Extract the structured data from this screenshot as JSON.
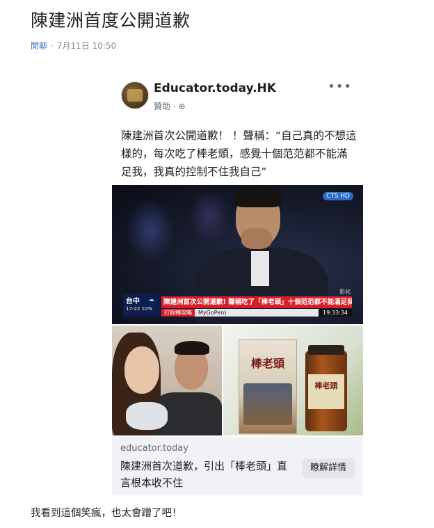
{
  "article": {
    "title": "陳建洲首度公開道歉",
    "category": "閒聊",
    "separator": "·",
    "timestamp": "7月11日 10:50"
  },
  "post": {
    "page_name": "Educator.today.HK",
    "sponsored": "贊助 · ⊕",
    "more_icon": "more-icon",
    "text": "陳建洲首次公開道歉！ ！聲稱：“自己真的不想這樣的，每次吃了棒老頭，感覺十個范范都不能滿足我，我真的控制不住我自己”",
    "video": {
      "channel_logo": "CTS HD",
      "location": "彰化",
      "weather_city": "台中",
      "weather_temp": "17-22 10%",
      "headline": "陳建洲首次公開道歉! 聲稱吃了「棒老頭」十個范范都不能滿足我!",
      "ticker_label": "打假轉攻略",
      "ticker_text": "MyGoPen)",
      "clock": "19:33:34"
    },
    "product": {
      "box_name": "棒老頭",
      "jar_name": "棒老頭"
    },
    "link": {
      "domain": "educator.today",
      "title": "陳建洲首次道歉，引出「棒老頭」直言根本收不住",
      "cta_label": "瞭解詳情"
    }
  },
  "caption": "我看到這個笑瘋，也太會蹭了吧！"
}
